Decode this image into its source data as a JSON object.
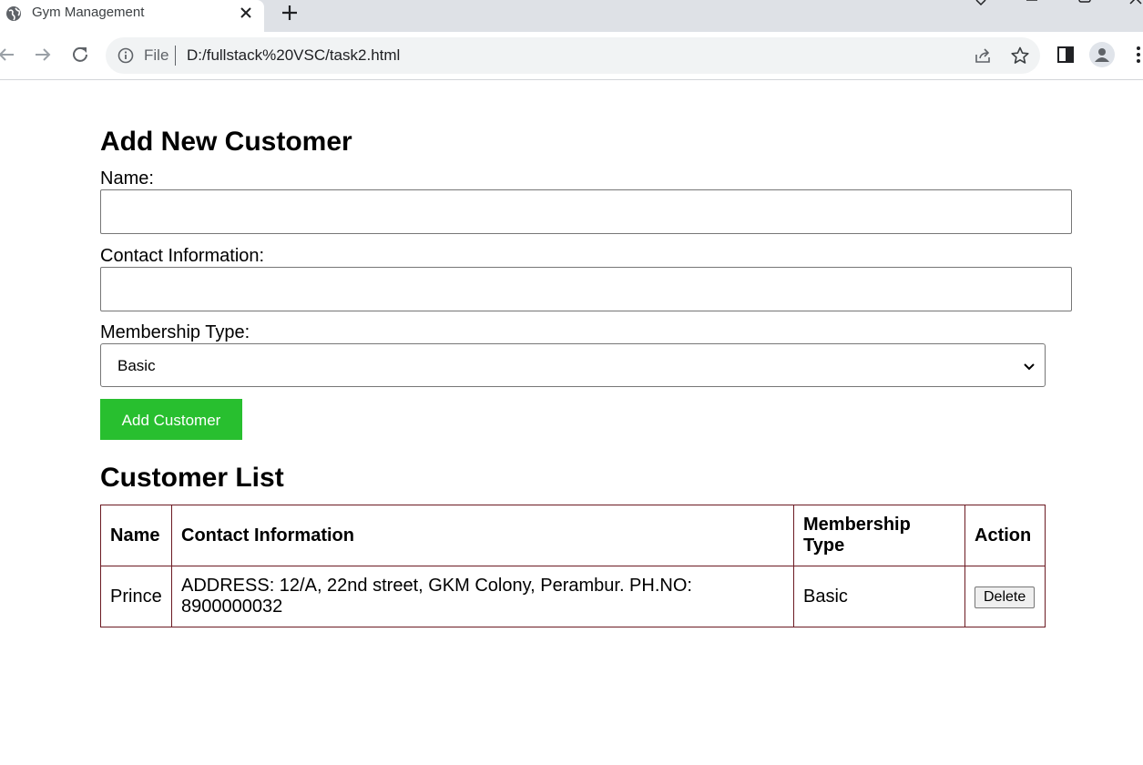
{
  "browser": {
    "tab_title": "Gym Management",
    "address_scheme": "File",
    "address_url": "D:/fullstack%20VSC/task2.html"
  },
  "form": {
    "heading": "Add New Customer",
    "name_label": "Name:",
    "name_value": "",
    "contact_label": "Contact Information:",
    "contact_value": "",
    "membership_label": "Membership Type:",
    "membership_selected": "Basic",
    "submit_label": "Add Customer",
    "submit_color": "#28bf2f"
  },
  "customer_list": {
    "heading": "Customer List",
    "columns": [
      "Name",
      "Contact Information",
      "Membership Type",
      "Action"
    ],
    "rows": [
      {
        "name": "Prince",
        "contact": "ADDRESS: 12/A, 22nd street, GKM Colony, Perambur. PH.NO: 8900000032",
        "membership": "Basic",
        "action_label": "Delete"
      }
    ],
    "border_color": "#6b1a22"
  },
  "icons": {
    "tab_favicon": "globe-icon",
    "tab_close": "close-icon",
    "new_tab": "plus-icon",
    "back": "back-arrow-icon",
    "forward": "forward-arrow-icon",
    "reload": "reload-icon",
    "site_info": "info-icon",
    "share": "share-icon",
    "bookmark": "star-icon",
    "side_panel": "side-panel-icon",
    "profile": "profile-icon",
    "menu": "kebab-menu-icon"
  }
}
